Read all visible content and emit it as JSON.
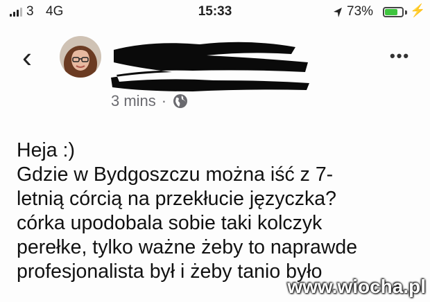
{
  "status_bar": {
    "carrier": "3",
    "network": "4G",
    "time": "15:33",
    "battery_percent_label": "73%",
    "battery_level": 0.73,
    "battery_color": "#3ec43e"
  },
  "header": {
    "back_icon": "chevron-left-icon",
    "more_icon": "more-dots-icon",
    "author_name_redacted": true
  },
  "post": {
    "time_ago": "3 mins",
    "separator": "·",
    "privacy_icon": "globe-icon",
    "lines": [
      "Heja :)",
      "Gdzie w Bydgoszczu można iść z 7-",
      "letnią córcią na przekłucie języczka?",
      "córka upodobala sobie taki kolczyk",
      "perełke, tylko ważne żeby to naprawde",
      "profesjonalista był i żeby tanio było"
    ]
  },
  "watermark": "www.wiocha.pl"
}
